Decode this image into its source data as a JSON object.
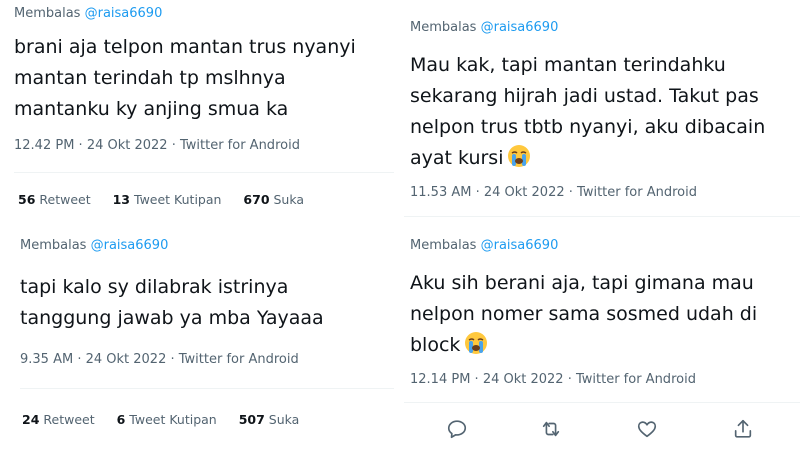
{
  "tweets": [
    {
      "reply_prefix": "Membalas",
      "reply_handle": "@raisa6690",
      "text_lines": [
        "brani aja telpon mantan trus nyanyi",
        "mantan terindah tp mslhnya",
        "mantanku ky anjing smua ka"
      ],
      "time": "12.42 PM",
      "date": "24 Okt 2022",
      "source": "Twitter for Android",
      "retweets": "56",
      "retweets_label": "Retweet",
      "quotes": "13",
      "quotes_label": "Tweet Kutipan",
      "likes": "670",
      "likes_label": "Suka"
    },
    {
      "reply_prefix": "Membalas",
      "reply_handle": "@raisa6690",
      "text_lines": [
        "Mau kak, tapi mantan terindahku",
        "sekarang hijrah jadi ustad. Takut pas",
        "nelpon trus tbtb nyanyi, aku dibacain",
        "ayat kursi"
      ],
      "emoji": "loudly-crying-face-emoji",
      "time": "11.53 AM",
      "date": "24 Okt 2022",
      "source": "Twitter for Android"
    },
    {
      "reply_prefix": "Membalas",
      "reply_handle": "@raisa6690",
      "text_lines": [
        "tapi kalo sy dilabrak istrinya",
        "tanggung jawab ya mba Yayaaa"
      ],
      "time": "9.35 AM",
      "date": "24 Okt 2022",
      "source": "Twitter for Android",
      "retweets": "24",
      "retweets_label": "Retweet",
      "quotes": "6",
      "quotes_label": "Tweet Kutipan",
      "likes": "507",
      "likes_label": "Suka"
    },
    {
      "reply_prefix": "Membalas",
      "reply_handle": "@raisa6690",
      "text_lines": [
        "Aku sih berani aja, tapi gimana mau",
        "nelpon nomer sama sosmed udah di",
        "block"
      ],
      "emoji": "loudly-crying-face-emoji",
      "time": "12.14 PM",
      "date": "24 Okt 2022",
      "source": "Twitter for Android",
      "actions": [
        "reply-icon",
        "retweet-icon",
        "like-icon",
        "share-icon"
      ]
    }
  ],
  "separator": " · ",
  "colors": {
    "text": "#0f1419",
    "secondary": "#536471",
    "link": "#1d9bf0",
    "divider": "#eff3f4"
  }
}
